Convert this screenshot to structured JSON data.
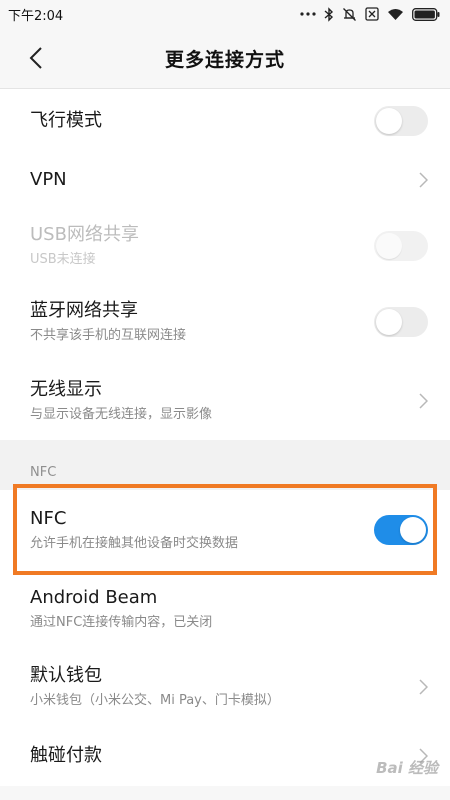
{
  "status_bar": {
    "time": "下午2:04",
    "icons": [
      "more-dots-icon",
      "bluetooth-icon",
      "mute-icon",
      "sim-icon",
      "wifi-icon",
      "battery-icon"
    ]
  },
  "header": {
    "title": "更多连接方式",
    "back_icon": "chevron-left-icon"
  },
  "rows": {
    "airplane": {
      "title": "飞行模式",
      "toggle": "off"
    },
    "vpn": {
      "title": "VPN"
    },
    "usb_tethering": {
      "title": "USB网络共享",
      "subtitle": "USB未连接",
      "toggle": "disabled"
    },
    "bt_tethering": {
      "title": "蓝牙网络共享",
      "subtitle": "不共享该手机的互联网连接",
      "toggle": "off"
    },
    "wireless_display": {
      "title": "无线显示",
      "subtitle": "与显示设备无线连接，显示影像"
    }
  },
  "nfc_section": {
    "header": "NFC",
    "nfc": {
      "title": "NFC",
      "subtitle": "允许手机在接触其他设备时交换数据",
      "toggle": "on"
    },
    "android_beam": {
      "title": "Android Beam",
      "subtitle": "通过NFC连接传输内容，已关闭"
    },
    "default_wallet": {
      "title": "默认钱包",
      "subtitle": "小米钱包（小米公交、Mi Pay、门卡模拟）"
    },
    "tap_pay": {
      "title": "触碰付款"
    }
  },
  "colors": {
    "accent": "#1f8de8",
    "highlight_box": "#f07a24"
  },
  "watermark": "Bai 经验"
}
